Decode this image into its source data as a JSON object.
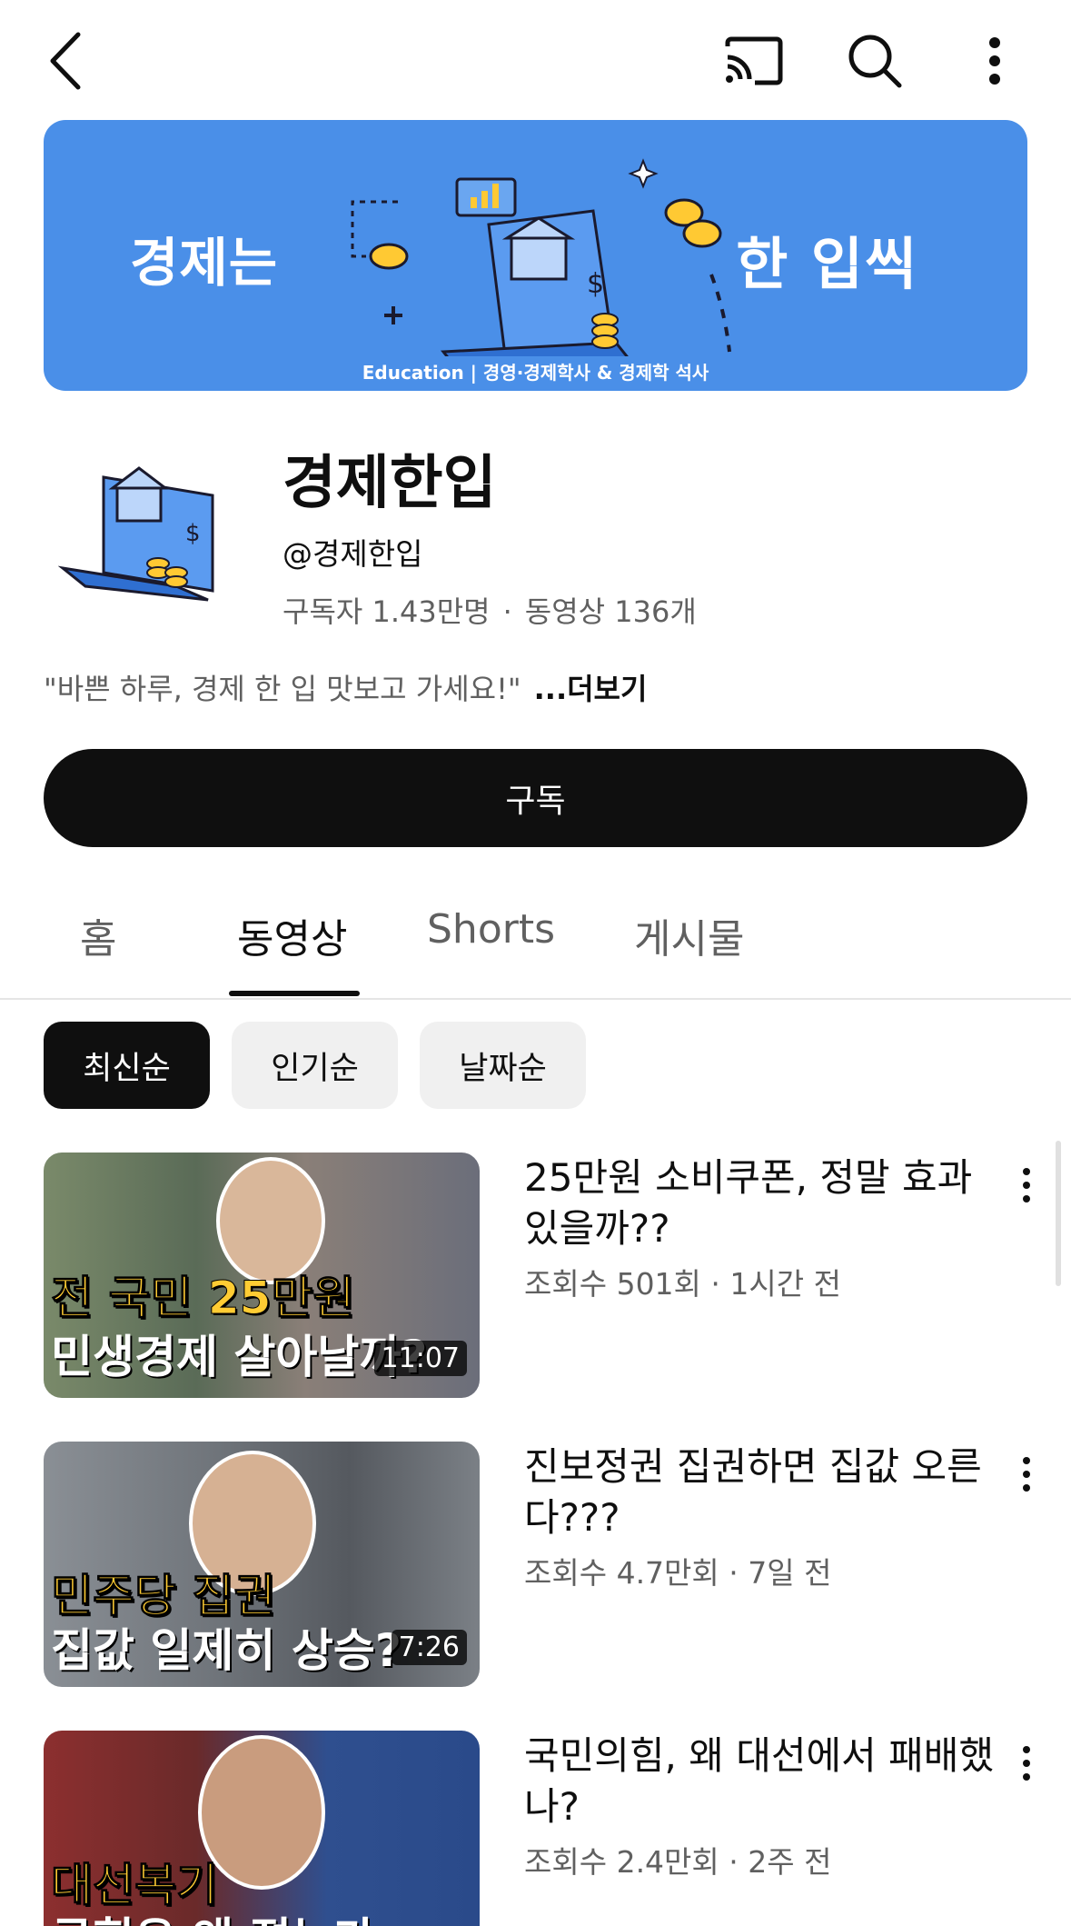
{
  "banner": {
    "left_text": "경제는",
    "right_text": "한 입씩",
    "subtitle": "Education  |  경영·경제학사 & 경제학 석사"
  },
  "channel": {
    "name": "경제한입",
    "handle": "@경제한입",
    "subscribers": "구독자 1.43만명",
    "videos": "동영상 136개",
    "description": "\"바쁜 하루, 경제 한 입 맛보고 가세요!\"",
    "more_label": "...더보기"
  },
  "subscribe_label": "구독",
  "tabs": [
    {
      "label": "홈"
    },
    {
      "label": "동영상"
    },
    {
      "label": "Shorts"
    },
    {
      "label": "게시물"
    }
  ],
  "chips": [
    {
      "label": "최신순"
    },
    {
      "label": "인기순"
    },
    {
      "label": "날짜순"
    }
  ],
  "videos": [
    {
      "title": "25만원 소비쿠폰, 정말 효과 있을까??",
      "meta": "조회수 501회 · 1시간 전",
      "duration": "11:07",
      "thumb_line1": "전 국민 25만원",
      "thumb_line2": "민생경제 살아날까?"
    },
    {
      "title": "진보정권 집권하면 집값 오른다???",
      "meta": "조회수 4.7만회 · 7일 전",
      "duration": "7:26",
      "thumb_line1": "민주당 집권",
      "thumb_line2": "집값 일제히 상승?"
    },
    {
      "title": "국민의힘, 왜 대선에서 패배했나?",
      "meta": "조회수 2.4만회 · 2주 전",
      "duration": "",
      "thumb_line1": "대선복기",
      "thumb_line2": "국힘은 왜 졌는가"
    }
  ]
}
